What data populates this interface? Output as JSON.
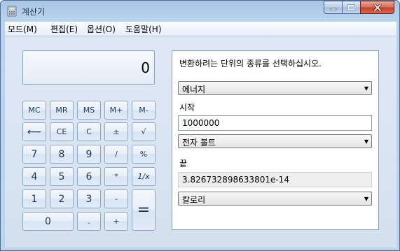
{
  "window": {
    "title": "계산기"
  },
  "menu": [
    "모드(M)",
    "편집(E)",
    "옵션(O)",
    "도움말(H)"
  ],
  "display": {
    "value": "0"
  },
  "keys": {
    "mc": "MC",
    "mr": "MR",
    "ms": "MS",
    "mplus": "M+",
    "mminus": "M-",
    "backspace": "⟵",
    "ce": "CE",
    "c": "C",
    "plusminus": "±",
    "sqrt": "√",
    "seven": "7",
    "eight": "8",
    "nine": "9",
    "divide": "/",
    "percent": "%",
    "four": "4",
    "five": "5",
    "six": "6",
    "multiply": "*",
    "reciprocal": "1/x",
    "one": "1",
    "two": "2",
    "three": "3",
    "minus": "-",
    "zero": "0",
    "decimal": ".",
    "plus": "+",
    "equals": "="
  },
  "converter": {
    "instruction": "변환하려는 단위의 종류를 선택하십시오.",
    "type_selected": "에너지",
    "from_label": "시작",
    "from_value": "1000000",
    "from_unit": "전자 볼트",
    "to_label": "끝",
    "to_value": "3.826732898633801e-14",
    "to_unit": "칼로리"
  },
  "icons": {
    "app": "calculator-icon",
    "minimize": "minimize-icon",
    "maximize": "maximize-icon",
    "close": "close-icon",
    "dropdown": "chevron-down-icon"
  }
}
